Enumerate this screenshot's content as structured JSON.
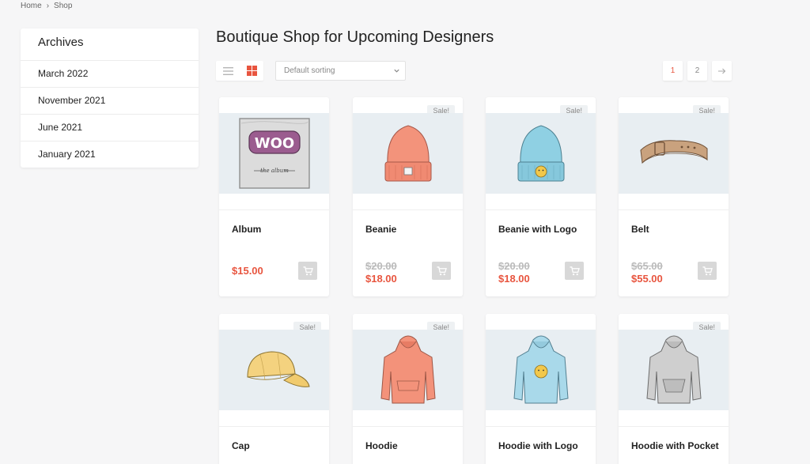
{
  "breadcrumb": {
    "home": "Home",
    "separator": "›",
    "current": "Shop"
  },
  "sidebar": {
    "title": "Archives",
    "items": [
      "March 2022",
      "November 2021",
      "June 2021",
      "January 2021"
    ]
  },
  "page_title": "Boutique Shop for Upcoming Designers",
  "toolbar": {
    "sort_value": "Default sorting",
    "active_view": "grid"
  },
  "pagination": {
    "pages": [
      "1",
      "2"
    ],
    "current": "1",
    "next_icon": "arrow-right-icon"
  },
  "colors": {
    "accent": "#e8553f",
    "image_bg": "#e8eef2",
    "cart_button": "#d8d8d8"
  },
  "products": [
    {
      "name": "Album",
      "sale": false,
      "price": "$15.00",
      "old_price": ""
    },
    {
      "name": "Beanie",
      "sale": true,
      "price": "$18.00",
      "old_price": "$20.00"
    },
    {
      "name": "Beanie with Logo",
      "sale": true,
      "price": "$18.00",
      "old_price": "$20.00"
    },
    {
      "name": "Belt",
      "sale": true,
      "price": "$55.00",
      "old_price": "$65.00"
    },
    {
      "name": "Cap",
      "sale": true,
      "price": "",
      "old_price": ""
    },
    {
      "name": "Hoodie",
      "sale": true,
      "price": "",
      "old_price": ""
    },
    {
      "name": "Hoodie with Logo",
      "sale": false,
      "price": "",
      "old_price": ""
    },
    {
      "name": "Hoodie with Pocket",
      "sale": true,
      "price": "",
      "old_price": ""
    }
  ],
  "sale_label": "Sale!"
}
